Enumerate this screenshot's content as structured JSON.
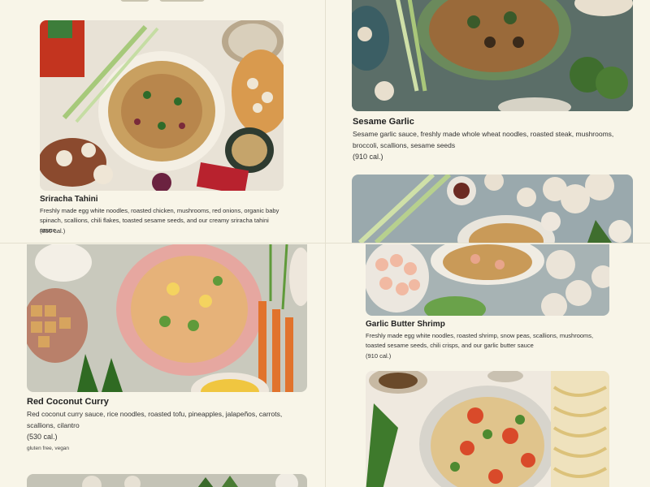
{
  "cards": [
    {
      "title": "Sriracha Tahini",
      "description": "Freshly made egg white noodles, roasted chicken, mushrooms, red onions, organic baby spinach, scallions, chili flakes, toasted sesame seeds, and our creamy sriracha tahini sauce.",
      "calories": "(830 cal.)"
    },
    {
      "title": "Sesame Garlic",
      "description": "Sesame garlic sauce, freshly made whole wheat noodles, roasted steak, mushrooms, broccoli, scallions, sesame seeds",
      "calories": "(910 cal.)"
    },
    {
      "title": "Red Coconut Curry",
      "description": "Red coconut curry sauce, rice noodles, roasted tofu, pineapples, jalapeños, carrots, scallions, cilantro",
      "calories": "(530 cal.)",
      "tags": "gluten free, vegan"
    },
    {
      "title": "Garlic Butter Shrimp",
      "description": "Freshly made egg white noodles, roasted shrimp, snow peas, scallions, mushrooms, toasted sesame seeds, chili crisps, and our garlic butter sauce",
      "calories": "(910 cal.)"
    }
  ]
}
